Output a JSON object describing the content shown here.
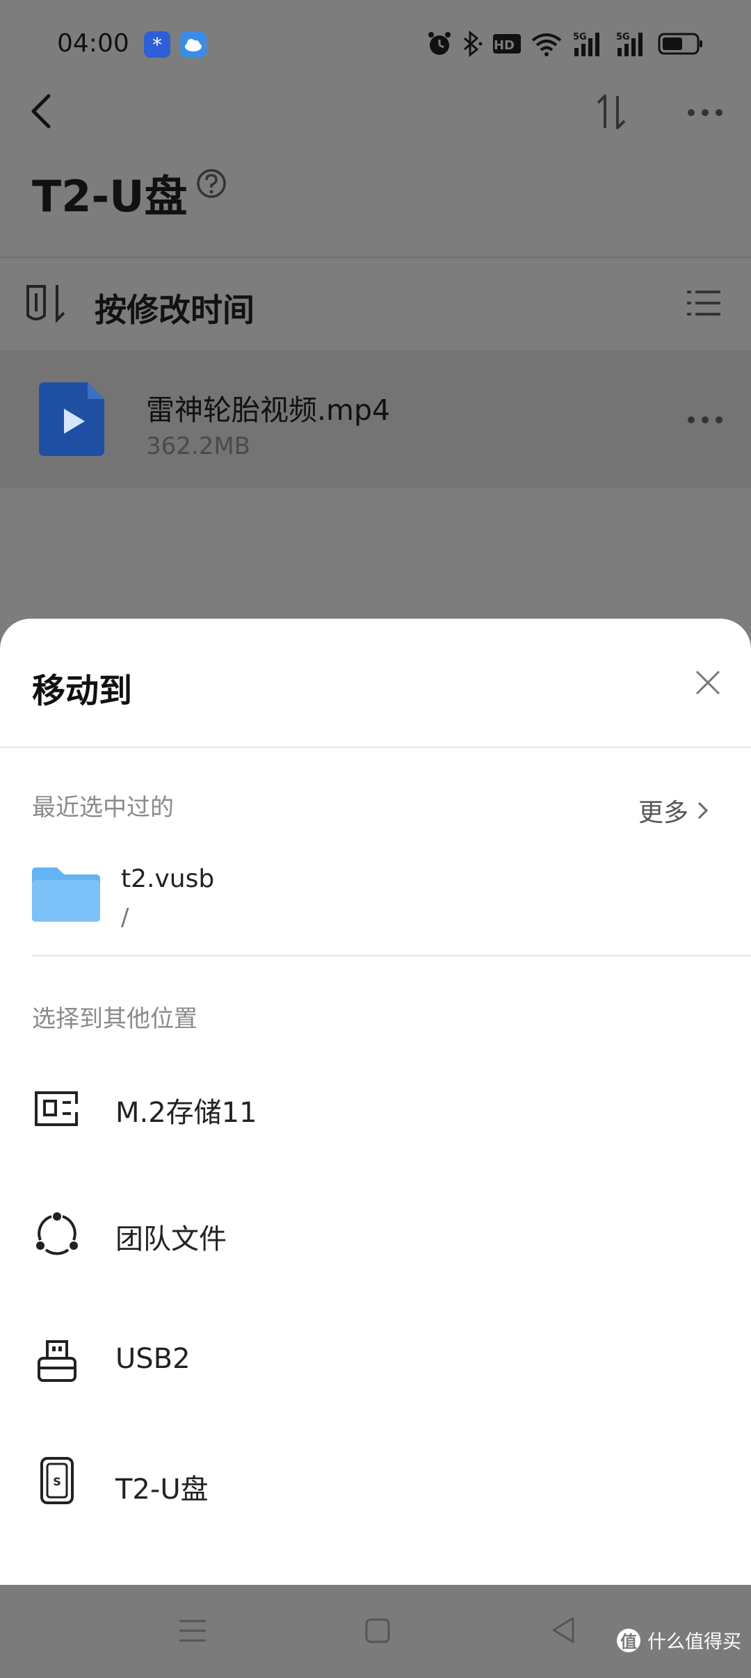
{
  "status_bar": {
    "time": "04:00",
    "app_icons": [
      "star-app-icon",
      "weather-app-icon"
    ],
    "indicators": [
      "alarm-icon",
      "bluetooth-icon",
      "hd-icon",
      "wifi-icon",
      "signal-5g-icon",
      "signal-5g-icon",
      "battery-icon"
    ]
  },
  "header": {
    "title": "T2-U盘"
  },
  "sort_bar": {
    "label": "按修改时间"
  },
  "file": {
    "name": "雷神轮胎视频.mp4",
    "size": "362.2MB"
  },
  "sheet": {
    "title": "移动到",
    "recent_label": "最近选中过的",
    "more_label": "更多",
    "recent_item": {
      "name": "t2.vusb",
      "path": "/"
    },
    "other_label": "选择到其他位置",
    "locations": [
      {
        "label": "M.2存储11",
        "icon": "ssd-storage-icon"
      },
      {
        "label": "团队文件",
        "icon": "team-share-icon"
      },
      {
        "label": "USB2",
        "icon": "usb-drive-icon"
      },
      {
        "label": "T2-U盘",
        "icon": "portable-drive-icon"
      }
    ]
  },
  "watermark": {
    "text": "什么值得买",
    "mark": "值"
  },
  "colors": {
    "folder_blue": "#64b3f4",
    "video_icon_blue": "#1e4fa3",
    "overlay_gray": "#7d7d7d"
  }
}
